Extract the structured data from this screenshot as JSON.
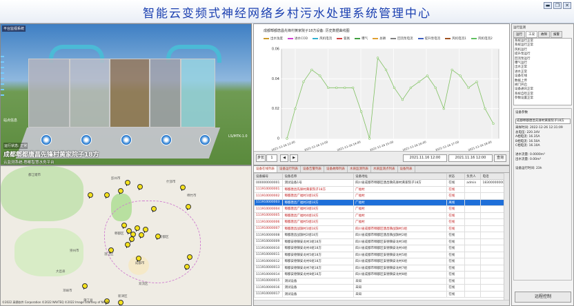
{
  "window": {
    "title": "智能云变频式神经网络乡村污水处理系统管理中心",
    "buttons": [
      "▬",
      "❐",
      "✕"
    ]
  },
  "scene": {
    "corner_tag": "平台监视系统",
    "station_name": "成都郫都唐昌先锋村黄家院子18方",
    "sub_text": "云监测系统-郫都智慧水务平台",
    "info_text": "运行状态: 正常",
    "side_labels": [
      "站点信息",
      "运行监测"
    ],
    "note": "LS/MTK-1.0"
  },
  "map": {
    "labels": [
      "都江堰市",
      "彭州市",
      "什邡市",
      "绵竹市",
      "郫都区",
      "成都市",
      "新都区",
      "温江区",
      "崇州市",
      "大邑县",
      "邛崃市",
      "蒲江县",
      "双流区",
      "新津区"
    ],
    "copyright": "©2022 高德软件 Corporation ©2022 NAVTEQ ©2022 Image courtesy of NASA"
  },
  "chart": {
    "title": "成都郫都唐昌先锋村黄家院子18方设备: 历史数据曲线图",
    "legend": [
      {
        "name": "出水浊度",
        "color": "#cc9a2a"
      },
      {
        "name": "进水COD",
        "color": "#d040d0"
      },
      {
        "name": "风机电流",
        "color": "#30b0d0"
      },
      {
        "name": "氨氮",
        "color": "#d04040"
      },
      {
        "name": "曝气",
        "color": "#40a040"
      },
      {
        "name": "总磷",
        "color": "#e0a030"
      },
      {
        "name": "回流泵电流",
        "color": "#808080"
      },
      {
        "name": "提升泵电流",
        "color": "#4060c0"
      },
      {
        "name": "风机电流1",
        "color": "#a05020"
      },
      {
        "name": "风机电流2",
        "color": "#60c060"
      }
    ],
    "controls": {
      "prev_label": "◀",
      "next_label": "▶",
      "step_label": "步长",
      "step_value": "1",
      "start_value": "2021.11.16 12:00",
      "end_value": "2021.11.16 12:00",
      "query_label": "查询"
    }
  },
  "chart_data": {
    "type": "line",
    "title": "",
    "xlabel": "",
    "ylabel": "",
    "ylim": [
      0,
      0.06
    ],
    "yticks": [
      "0.06",
      "0.04",
      "0.02",
      "0"
    ],
    "xticks": [
      "2021-11-16 12:00",
      "2021-11-16 13:00",
      "2021-11-16 14:00",
      "2021-11-16 15:00",
      "2021-11-16 16:00",
      "2021-11-16 17:00",
      "2021-11-16 18:00"
    ],
    "series": [
      {
        "name": "风机电流2",
        "values": [
          0,
          0.02,
          0.038,
          0.046,
          0.042,
          0.034,
          0.034,
          0.034,
          0.034,
          0.018,
          0,
          0.054,
          0.046,
          0.034,
          0.026,
          0.034,
          0.038,
          0.042,
          0.034,
          0.02,
          0.046,
          0.042,
          0.034,
          0.038,
          0.02,
          0.01
        ]
      }
    ]
  },
  "table": {
    "tabs": [
      "设备在线列表",
      "设备运行列表",
      "设备告警列表",
      "设备故障列表",
      "水质监测列表",
      "水质监测点列表",
      "设备列表"
    ],
    "columns": [
      "设备编号",
      "设备名称",
      "设备地址",
      "状态",
      "负责人",
      "电话"
    ],
    "rows": [
      {
        "cells": [
          "000000000001",
          "测试设备1号",
          "四川省成都市郫都区唐昌镇先锋村黄家院子18方",
          "在线",
          "admin",
          "18300000000"
        ]
      },
      {
        "cells": [
          "111910000001",
          "郫都唐昌先锋村黄家院子18方",
          "广福村",
          "在线",
          "",
          ""
        ],
        "cls": "red"
      },
      {
        "cells": [
          "111910000002",
          "郫都唐昌广福村1组18方",
          "广福村",
          "在线",
          "",
          ""
        ],
        "cls": "red"
      },
      {
        "cells": [
          "111910000003",
          "郫都唐昌广福村2组18方",
          "广福村",
          "离线",
          "",
          ""
        ],
        "cls": "sel"
      },
      {
        "cells": [
          "111910000004",
          "郫都唐昌广福村3组18方",
          "广福村",
          "在线",
          "",
          ""
        ],
        "cls": "red"
      },
      {
        "cells": [
          "111910000005",
          "郫都唐昌广福村4组18方",
          "广福村",
          "在线",
          "",
          ""
        ],
        "cls": "red"
      },
      {
        "cells": [
          "111910000006",
          "郫都唐昌广福村5组18方",
          "广福村",
          "在线",
          "",
          ""
        ],
        "cls": "red"
      },
      {
        "cells": [
          "111910000007",
          "郫都唐昌战旗村1组18方",
          "四川省成都市郫都区唐昌镇战旗村1组",
          "在线",
          "",
          ""
        ],
        "cls": "red"
      },
      {
        "cells": [
          "111910000008",
          "郫都唐昌战旗村2组18方",
          "四川省成都市郫都区唐昌镇战旗村2组",
          "在线",
          "",
          ""
        ]
      },
      {
        "cells": [
          "111910000009",
          "郫都安德镇安龙村3组18方",
          "四川省成都市郫都区安德镇安龙村3组",
          "在线",
          "",
          ""
        ]
      },
      {
        "cells": [
          "111910000010",
          "郫都安德镇安龙村4组18方",
          "四川省成都市郫都区安德镇安龙村4组",
          "在线",
          "",
          ""
        ]
      },
      {
        "cells": [
          "111910000011",
          "郫都安德镇安龙村5组18方",
          "四川省成都市郫都区安德镇安龙村5组",
          "在线",
          "",
          ""
        ]
      },
      {
        "cells": [
          "111910000012",
          "郫都安德镇安龙村6组18方",
          "四川省成都市郫都区安德镇安龙村6组",
          "在线",
          "",
          ""
        ]
      },
      {
        "cells": [
          "111910000013",
          "郫都安德镇安龙村7组18方",
          "四川省成都市郫都区安德镇安龙村7组",
          "在线",
          "",
          ""
        ]
      },
      {
        "cells": [
          "111910000014",
          "郫都安德镇安龙村8组18方",
          "四川省成都市郫都区安德镇安龙村8组",
          "在线",
          "",
          ""
        ]
      },
      {
        "cells": [
          "111910000015",
          "测试设备",
          "未知",
          "在线",
          "",
          ""
        ]
      },
      {
        "cells": [
          "111910000016",
          "测试设备",
          "未知",
          "在线",
          "",
          ""
        ]
      },
      {
        "cells": [
          "111910000017",
          "测试设备",
          "未知",
          "在线",
          "",
          ""
        ]
      }
    ]
  },
  "sidebar": {
    "header": "运行监测",
    "tabs": [
      "运行",
      "工况",
      "故障",
      "报警"
    ],
    "list": [
      "系统运行正常",
      "系统运行正常",
      "风机运行",
      "提升泵运行",
      "回流泵运行",
      "曝气运行",
      "出水正常",
      "进水正常",
      "设备在线",
      "数据上传",
      "阀门开启",
      "设备通讯正常",
      "系统自检正常",
      "参数设置正常"
    ],
    "group_title": "设备参数",
    "select_value": "成都郫都唐昌先锋村黄家院子18方",
    "kv": [
      "采样时间: 2022-12-26 12:31:09",
      "总电压: 220.34V",
      "A相电流: 16.35A",
      "B相电流: 16.50A",
      "C相电流: 16.10A",
      "",
      "进水流量: 0.0000m³",
      "出水流量: 0.00m³",
      "",
      "设备运行时间: 23h"
    ],
    "query_label": "远程控制"
  }
}
